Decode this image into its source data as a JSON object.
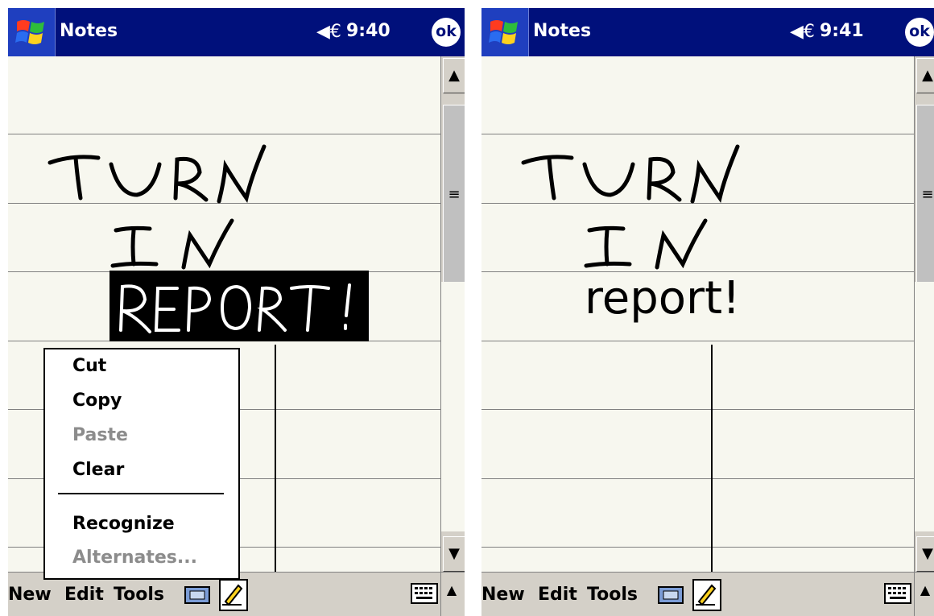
{
  "left": {
    "title": "Notes",
    "time": "9:40",
    "ok_label": "ok",
    "menus": [
      "New",
      "Edit",
      "Tools"
    ],
    "context_menu": {
      "items": [
        {
          "label": "Cut",
          "enabled": true
        },
        {
          "label": "Copy",
          "enabled": true
        },
        {
          "label": "Paste",
          "enabled": false
        },
        {
          "label": "Clear",
          "enabled": true
        },
        {
          "label": "Recognize",
          "enabled": true
        },
        {
          "label": "Alternates...",
          "enabled": false
        }
      ]
    },
    "handwriting_label": "TURN IN REPORT!"
  },
  "right": {
    "title": "Notes",
    "time": "9:41",
    "ok_label": "ok",
    "menus": [
      "New",
      "Edit",
      "Tools"
    ],
    "recognized_text": "report!",
    "handwriting_label": "TURN IN"
  },
  "icons": {
    "start": "windows-flag-icon",
    "speaker": "speaker-icon",
    "ok": "ok-icon",
    "recorder": "recorder-icon",
    "pen": "pen-icon",
    "keyboard": "keyboard-icon",
    "up_arrow": "up-arrow-icon"
  },
  "colors": {
    "titlebar": "#00107b",
    "menubar": "#d4d0c8",
    "paper": "#f7f7ef",
    "rules": "#808080"
  }
}
